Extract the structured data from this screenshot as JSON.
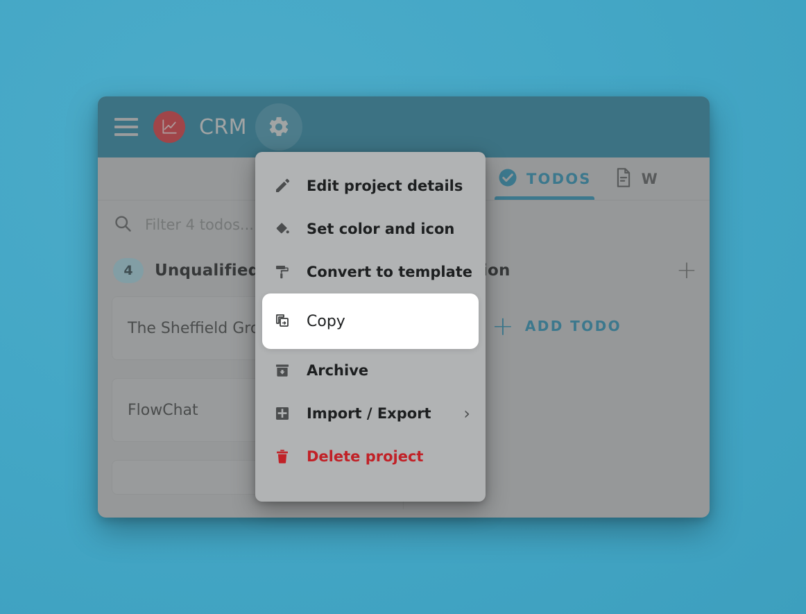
{
  "theme": {
    "page_background": "#44a7c6",
    "header_background": "#1c7390",
    "accent_blue": "#1b7da0",
    "logo_red": "#c1282f",
    "danger_red": "#c12127",
    "menu_background": "#b1b3b4",
    "highlight_background": "#ffffff"
  },
  "header": {
    "menu_icon": "hamburger-icon",
    "logo_icon": "line-chart-icon",
    "title": "CRM",
    "settings_icon": "gear-icon"
  },
  "tabs": [
    {
      "id": "todos",
      "label": "TODOS",
      "icon": "check-circle-icon",
      "active": true
    },
    {
      "id": "wiki",
      "label": "W",
      "icon": "document-icon",
      "active": false
    }
  ],
  "filter": {
    "icon": "search-icon",
    "value": "",
    "placeholder": "Filter 4 todos..."
  },
  "columns": [
    {
      "id": "unqualified",
      "count": "4",
      "title": "Unqualified",
      "add_icon": "plus-icon",
      "cards": [
        {
          "title": "The Sheffield Gro"
        },
        {
          "title": "FlowChat"
        },
        {
          "title": ""
        }
      ]
    },
    {
      "id": "qualification",
      "count": "",
      "title": "alification",
      "add_icon": "plus-icon",
      "cards": [],
      "add_todo": {
        "icon": "plus-icon",
        "label": "ADD TODO"
      }
    }
  ],
  "menu": {
    "items": [
      {
        "id": "edit-project-details",
        "label": "Edit project details",
        "icon": "pencil-icon",
        "submenu": false,
        "highlighted": false,
        "danger": false
      },
      {
        "id": "set-color-and-icon",
        "label": "Set color and icon",
        "icon": "paint-bucket-icon",
        "submenu": true,
        "highlighted": false,
        "danger": false
      },
      {
        "id": "convert-to-template",
        "label": "Convert to template",
        "icon": "paint-roller-icon",
        "submenu": false,
        "highlighted": false,
        "danger": false
      },
      {
        "id": "copy",
        "label": "Copy",
        "icon": "copy-icon",
        "submenu": false,
        "highlighted": true,
        "danger": false
      },
      {
        "id": "archive",
        "label": "Archive",
        "icon": "archive-icon",
        "submenu": false,
        "highlighted": false,
        "danger": false
      },
      {
        "id": "import-export",
        "label": "Import / Export",
        "icon": "import-export-icon",
        "submenu": true,
        "highlighted": false,
        "danger": false
      },
      {
        "id": "delete-project",
        "label": "Delete project",
        "icon": "trash-icon",
        "submenu": false,
        "highlighted": false,
        "danger": true
      }
    ],
    "chevron_glyph": "›"
  }
}
